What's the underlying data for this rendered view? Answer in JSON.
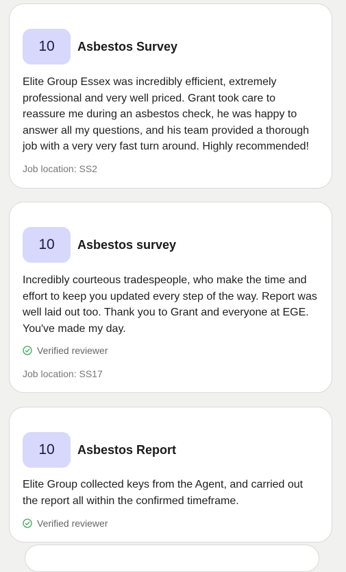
{
  "colors": {
    "page_background": "#f1f1ef",
    "card_background": "#ffffff",
    "score_badge": "#d7d8fb",
    "verified_check": "#3aa564"
  },
  "reviews": [
    {
      "score": "10",
      "title": "Asbestos Survey",
      "text": "Elite Group Essex was incredibly efficient, extremely professional and very well priced. Grant took care to reassure me during an asbestos check, he was happy to answer all my questions, and his team provided a thorough job with a very very fast turn around. Highly recommended!",
      "location": "Job location: SS2"
    },
    {
      "score": "10",
      "title": "Asbestos survey",
      "text": "Incredibly courteous tradespeople, who make the time and effort to keep you updated every step of the way. Report was well laid out too. Thank you to Grant and everyone at EGE. You've made my day.",
      "verified": "Verified reviewer",
      "location": "Job location: SS17"
    },
    {
      "score": "10",
      "title": "Asbestos Report",
      "text": "Elite Group collected keys from the Agent, and carried out the report all within the confirmed timeframe.",
      "verified": "Verified reviewer"
    }
  ],
  "icons": {
    "verified": "check-circle-icon",
    "menu": "more-options-icon"
  }
}
